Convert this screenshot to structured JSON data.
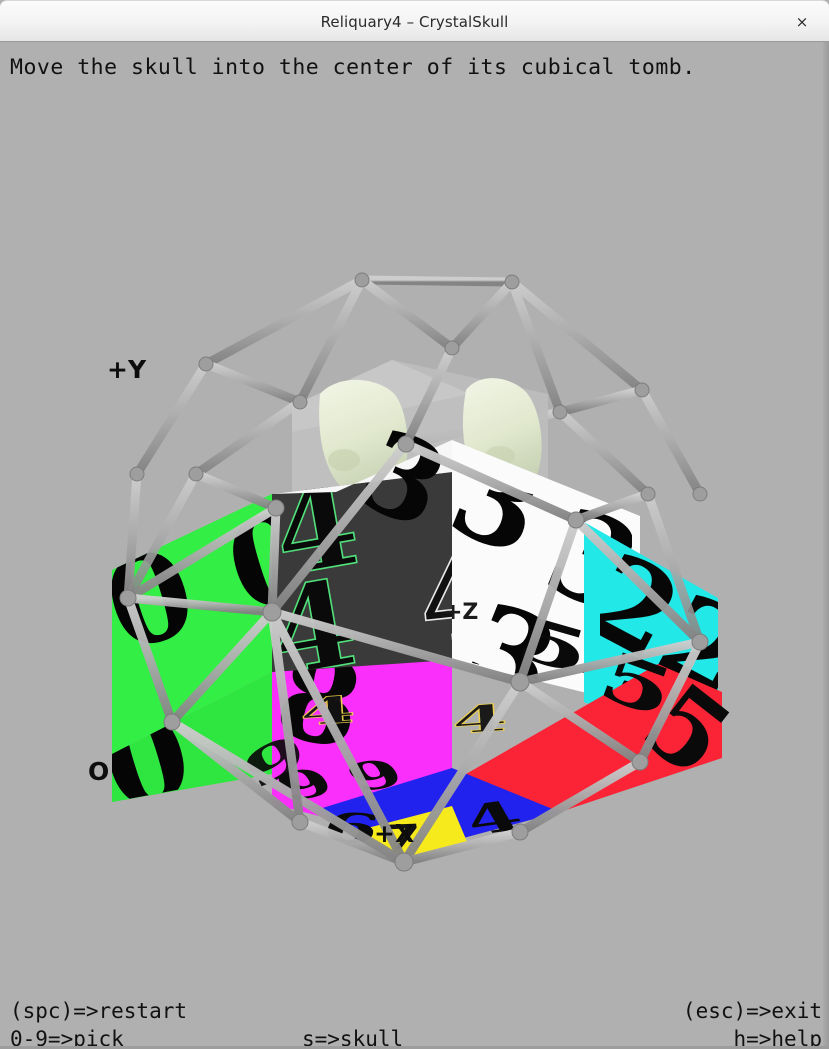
{
  "window": {
    "title": "Reliquary4 – CrystalSkull",
    "close_label": "×",
    "background_color": "#b0b0b0",
    "titlebar_color": "#f3f3f3"
  },
  "hud": {
    "instruction": "Move the skull into the center of its cubical tomb.",
    "footer": {
      "restart": "(spc)=>restart",
      "exit": "(esc)=>exit",
      "pick": "0-9=>pick",
      "skull": "s=>skull",
      "help": "h=>help"
    }
  },
  "scene": {
    "axes": {
      "origin": "O",
      "x": "+X",
      "y": "+Y",
      "z": "+Z"
    },
    "cage": {
      "name": "wireframe-cage",
      "rod_color": "#a8a8a8",
      "rod_shadow": "#7f7f7f"
    },
    "tomb": {
      "name": "translucent-tomb",
      "color": "#c4c4c4"
    },
    "skull": {
      "name": "crystal-skull",
      "color": "#e6ecd8"
    },
    "cube": {
      "faces": [
        {
          "position": "left-upper",
          "color": "#33ee44",
          "digit": "0"
        },
        {
          "position": "left-lower",
          "color": "#33ee44",
          "digit": "0"
        },
        {
          "position": "left-front",
          "color": "#ff33ff",
          "digit": "8"
        },
        {
          "position": "bottom-left",
          "color": "#ff33ff",
          "digit": "9"
        },
        {
          "position": "front-upper",
          "color": "#3a3a3a",
          "digit": "4"
        },
        {
          "position": "front-lower",
          "color": "#2e2e2e",
          "digit": "4"
        },
        {
          "position": "top-right",
          "color": "#ffffff",
          "digit": "3"
        },
        {
          "position": "right-upper",
          "color": "#ffffff",
          "digit": "3"
        },
        {
          "position": "right-side",
          "color": "#22e8e8",
          "digit": "2"
        },
        {
          "position": "right-lower",
          "color": "#ff2b3d",
          "digit": "5"
        },
        {
          "position": "bottom-mid",
          "color": "#2222ee",
          "digit": "6"
        },
        {
          "position": "bottom-tip",
          "color": "#f7ea1c",
          "digit": "7"
        }
      ],
      "digits_visible": [
        "0",
        "2",
        "3",
        "4",
        "5",
        "6",
        "7",
        "8",
        "9"
      ]
    }
  }
}
